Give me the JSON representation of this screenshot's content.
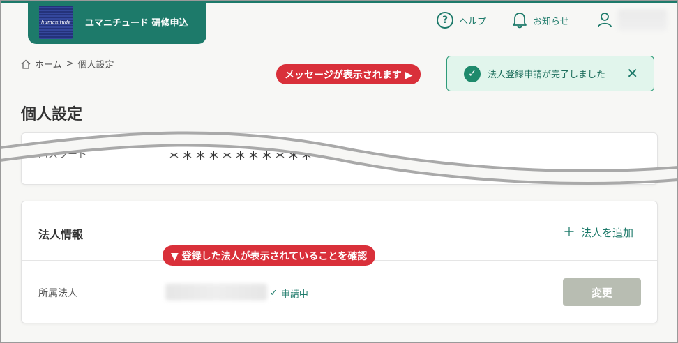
{
  "header": {
    "brand_name": "ユマニチュード 研修申込",
    "logo_text": "humanitude",
    "help_label": "ヘルプ",
    "notice_label": "お知らせ"
  },
  "breadcrumb": {
    "home": "ホーム",
    "separator": ">",
    "current": "個人設定"
  },
  "annotations": {
    "message_callout": "メッセージが表示されます ▶",
    "corp_callout": "▼ 登録した法人が表示されていることを確認"
  },
  "toast": {
    "message": "法人登録申請が完了しました"
  },
  "page": {
    "title": "個人設定"
  },
  "password_section": {
    "label": "パスワード",
    "value": "＊＊＊＊＊＊＊＊＊＊＊"
  },
  "corp_section": {
    "title": "法人情報",
    "add_label": "法人を追加",
    "row_label": "所属法人",
    "status": "申請中",
    "change_button": "変更"
  },
  "colors": {
    "brand": "#1d7a6a",
    "callout": "#d9303a",
    "toast_bg": "#e1f5ec",
    "disabled_button": "#b8bdb2"
  }
}
